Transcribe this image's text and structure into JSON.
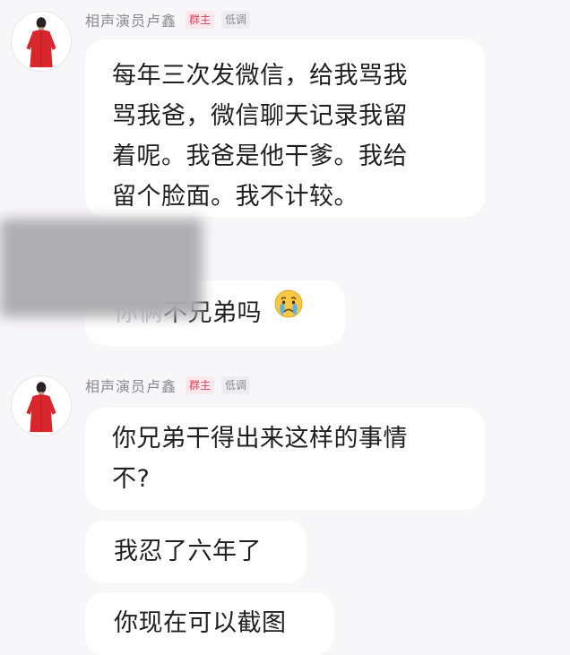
{
  "colors": {
    "background": "#f7f6f9",
    "bubble": "#ffffff",
    "owner_badge_text": "#e23f5a",
    "robe": "#d8262c"
  },
  "messages": [
    {
      "sender": "相声演员卢鑫",
      "role_badge": "群主",
      "level_badge": "低调",
      "avatar_icon": "person-in-red-robe-icon",
      "lines": [
        "每年三次发微信，给我骂我",
        "骂我爸，微信聊天记录我留",
        "着呢。我爸是他干爹。我给",
        "留个脸面。我不计较。"
      ]
    },
    {
      "partial_text": "不兄弟吗",
      "emoji_icon": "crying-face-icon"
    },
    {
      "sender": "相声演员卢鑫",
      "role_badge": "群主",
      "level_badge": "低调",
      "avatar_icon": "person-in-red-robe-icon",
      "lines": [
        "你兄弟干得出来这样的事情",
        "不?"
      ]
    },
    {
      "text": "我忍了六年了"
    },
    {
      "text": "你现在可以截图"
    }
  ]
}
